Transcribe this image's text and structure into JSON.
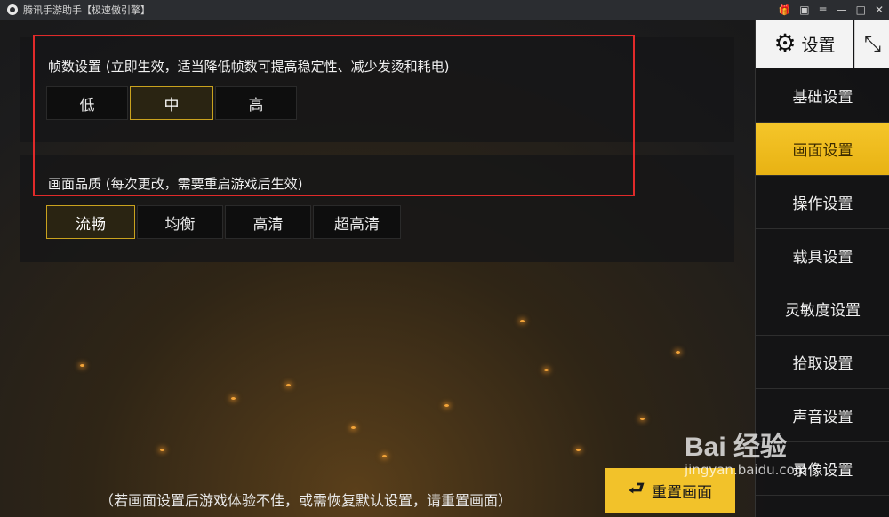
{
  "window": {
    "title": "腾讯手游助手【极速傲引擎】",
    "controls": [
      "▣",
      "≡",
      "—",
      "□",
      "✕"
    ],
    "gift_icon": "🎁"
  },
  "fps_section": {
    "label": "帧数设置 (立即生效，适当降低帧数可提高稳定性、减少发烫和耗电)",
    "options": [
      "低",
      "中",
      "高"
    ],
    "selected": "中"
  },
  "quality_section": {
    "label": "画面品质 (每次更改，需要重启游戏后生效)",
    "options": [
      "流畅",
      "均衡",
      "高清",
      "超高清"
    ],
    "selected": "流畅"
  },
  "sidebar": {
    "header_label": "设置",
    "header_icon": "gear-icon",
    "close_icon": "⤡",
    "items": [
      {
        "label": "基础设置",
        "active": false
      },
      {
        "label": "画面设置",
        "active": true
      },
      {
        "label": "操作设置",
        "active": false
      },
      {
        "label": "载具设置",
        "active": false
      },
      {
        "label": "灵敏度设置",
        "active": false
      },
      {
        "label": "拾取设置",
        "active": false
      },
      {
        "label": "声音设置",
        "active": false
      },
      {
        "label": "录像设置",
        "active": false
      }
    ]
  },
  "footer": {
    "note": "（若画面设置后游戏体验不佳，或需恢复默认设置，请重置画面）",
    "reset_label": "重置画面"
  },
  "watermark": {
    "logo": "Bai 经验",
    "url": "jingyan.baidu.com"
  },
  "colors": {
    "accent": "#f2c22a",
    "highlight": "#e02a2a"
  }
}
